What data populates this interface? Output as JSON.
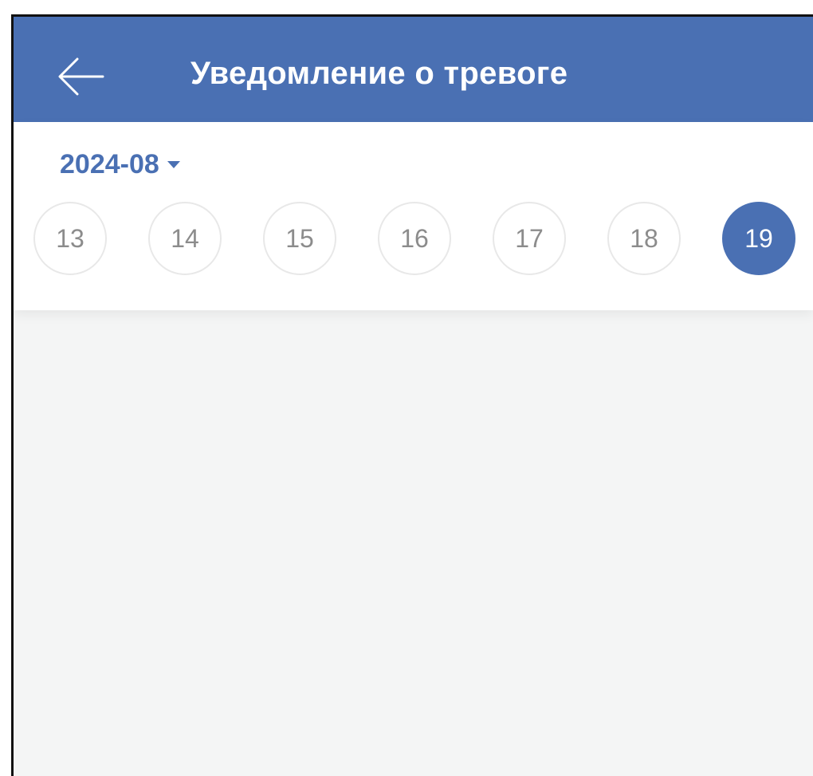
{
  "header": {
    "title": "Уведомление о тревоге",
    "back_icon": "arrow-left-icon",
    "background": "#4a70b3"
  },
  "date_selector": {
    "month": "2024-08",
    "dropdown_icon": "caret-down-icon",
    "accent": "#4a70b3",
    "days": [
      {
        "label": "13",
        "selected": false
      },
      {
        "label": "14",
        "selected": false
      },
      {
        "label": "15",
        "selected": false
      },
      {
        "label": "16",
        "selected": false
      },
      {
        "label": "17",
        "selected": false
      },
      {
        "label": "18",
        "selected": false
      },
      {
        "label": "19",
        "selected": true
      }
    ]
  },
  "content": {
    "background": "#f4f5f5"
  }
}
